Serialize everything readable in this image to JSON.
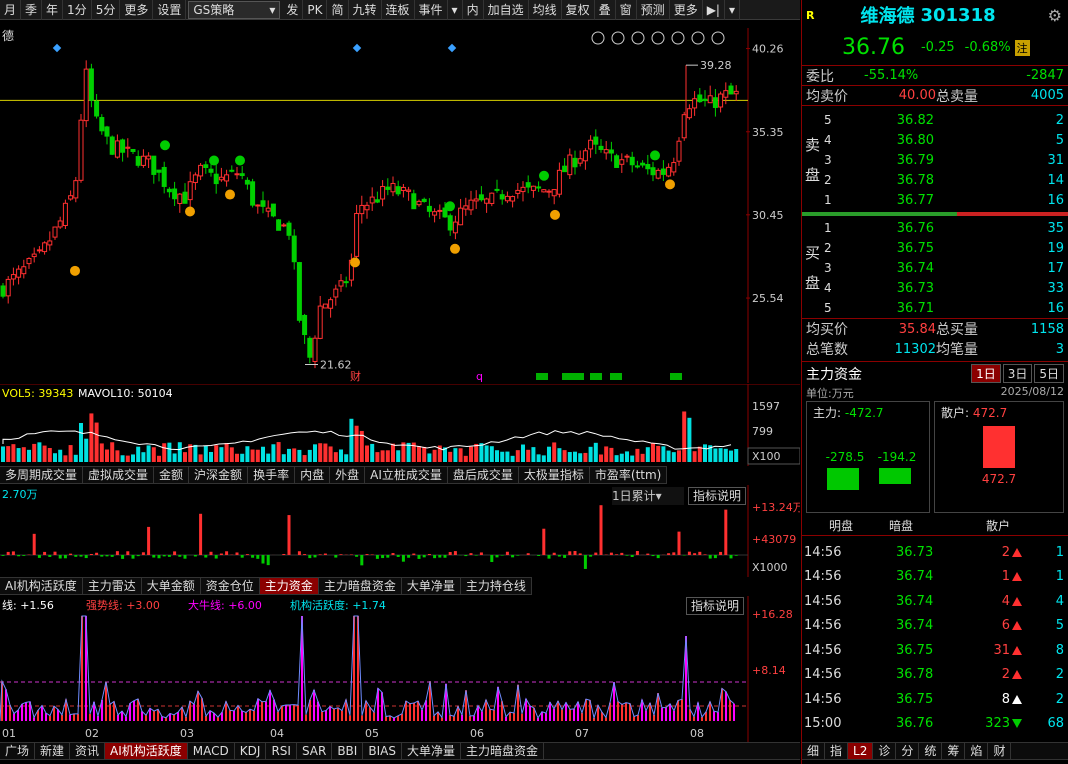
{
  "toolbar": {
    "items": [
      "月",
      "季",
      "年",
      "1分",
      "5分",
      "更多",
      "设置"
    ],
    "strategy_select": "GS策略",
    "items2": [
      "发",
      "PK",
      "简",
      "九转",
      "连板",
      "事件"
    ],
    "items3": [
      "内",
      "加自选",
      "均线",
      "复权",
      "叠",
      "窗",
      "预测",
      "更多"
    ]
  },
  "chart_top_label": "德",
  "price_axis": [
    "40.26",
    "35.35",
    "30.45",
    "25.54"
  ],
  "high_label": "39.28",
  "low_label": "21.62",
  "event_markers": {
    "cai": "财",
    "q": "q"
  },
  "volume": {
    "legend_a": "VOL5: 39343",
    "legend_b": "MAVOL10: 50104",
    "axis": [
      "1597",
      "799",
      "X100"
    ]
  },
  "tabs_mid": [
    "多周期成交量",
    "虚拟成交量",
    "金额",
    "沪深金额",
    "换手率",
    "内盘",
    "外盘",
    "AI立桩成交量",
    "盘后成交量",
    "太极量指标",
    "市盈率(ttm)"
  ],
  "capital": {
    "legend": "2.70万",
    "period": "1日累计",
    "explain": "指标说明",
    "axis": [
      "+13.24万",
      "+43079",
      "X1000"
    ]
  },
  "tabs_cap": [
    "AI机构活跃度",
    "主力雷达",
    "大单金额",
    "资金仓位",
    "主力资金",
    "主力暗盘资金",
    "大单净量",
    "主力持仓线"
  ],
  "ai": {
    "legend": [
      {
        "label": "线: +1.56",
        "color": "#ffffff"
      },
      {
        "label": "强势线: +3.00",
        "color": "#ff4040"
      },
      {
        "label": "大牛线: +6.00",
        "color": "#ff00ff"
      },
      {
        "label": "机构活跃度: +1.74",
        "color": "#00e5ee"
      }
    ],
    "explain": "指标说明",
    "axis": [
      "+16.28",
      "+8.14"
    ],
    "months": [
      "01",
      "02",
      "03",
      "04",
      "05",
      "06",
      "07",
      "08"
    ]
  },
  "tabs_bottom": [
    "广场",
    "新建",
    "资讯",
    "AI机构活跃度",
    "MACD",
    "KDJ",
    "RSI",
    "SAR",
    "BBI",
    "BIAS",
    "大单净量",
    "主力暗盘资金"
  ],
  "quote": {
    "badge": "R",
    "name": "维海德",
    "code": "301318",
    "price": "36.76",
    "change": "-0.25",
    "pct": "-0.68%",
    "tag": "注",
    "weibi_label": "委比",
    "weibi": "-55.14%",
    "weicha": "-2847",
    "avg_sell_label": "均卖价",
    "avg_sell": "40.00",
    "total_sell_label": "总卖量",
    "total_sell": "4005",
    "sell_side": "卖盘",
    "buy_side": "买盘",
    "asks": [
      {
        "lv": "5",
        "p": "36.82",
        "v": "2"
      },
      {
        "lv": "4",
        "p": "36.80",
        "v": "5"
      },
      {
        "lv": "3",
        "p": "36.79",
        "v": "31"
      },
      {
        "lv": "2",
        "p": "36.78",
        "v": "14"
      },
      {
        "lv": "1",
        "p": "36.77",
        "v": "16"
      }
    ],
    "bids": [
      {
        "lv": "1",
        "p": "36.76",
        "v": "35"
      },
      {
        "lv": "2",
        "p": "36.75",
        "v": "19"
      },
      {
        "lv": "3",
        "p": "36.74",
        "v": "17"
      },
      {
        "lv": "4",
        "p": "36.73",
        "v": "33"
      },
      {
        "lv": "5",
        "p": "36.71",
        "v": "16"
      }
    ],
    "avg_buy_label": "均买价",
    "avg_buy": "35.84",
    "total_buy_label": "总买量",
    "total_buy": "1158",
    "total_trades_label": "总笔数",
    "total_trades": "11302",
    "avg_trade_label": "均笔量",
    "avg_trade": "3"
  },
  "main_fund": {
    "title": "主力资金",
    "periods": [
      "1日",
      "3日",
      "5日"
    ],
    "unit": "单位:万元",
    "date": "2025/08/12",
    "main_label": "主力:",
    "main_val": "-472.7",
    "retail_label": "散户:",
    "retail_val": "472.7",
    "ming_val": "-278.5",
    "an_val": "-194.2",
    "retail_bar_val": "472.7",
    "col_ming": "明盘",
    "col_an": "暗盘",
    "col_retail": "散户"
  },
  "ticks": [
    {
      "t": "14:56",
      "p": "36.73",
      "v": "2",
      "d": "up",
      "n": "1"
    },
    {
      "t": "14:56",
      "p": "36.74",
      "v": "1",
      "d": "up",
      "n": "1"
    },
    {
      "t": "14:56",
      "p": "36.74",
      "v": "4",
      "d": "up",
      "n": "4"
    },
    {
      "t": "14:56",
      "p": "36.74",
      "v": "6",
      "d": "up",
      "n": "5"
    },
    {
      "t": "14:56",
      "p": "36.75",
      "v": "31",
      "d": "up",
      "n": "8"
    },
    {
      "t": "14:56",
      "p": "36.78",
      "v": "2",
      "d": "up",
      "n": "2"
    },
    {
      "t": "14:56",
      "p": "36.75",
      "v": "8",
      "d": "flat",
      "n": "2"
    },
    {
      "t": "15:00",
      "p": "36.76",
      "v": "323",
      "d": "down",
      "n": "68"
    }
  ],
  "bottom_tabs_right": [
    "细",
    "指",
    "L2",
    "诊",
    "分",
    "统",
    "筹",
    "焰",
    "财"
  ]
}
